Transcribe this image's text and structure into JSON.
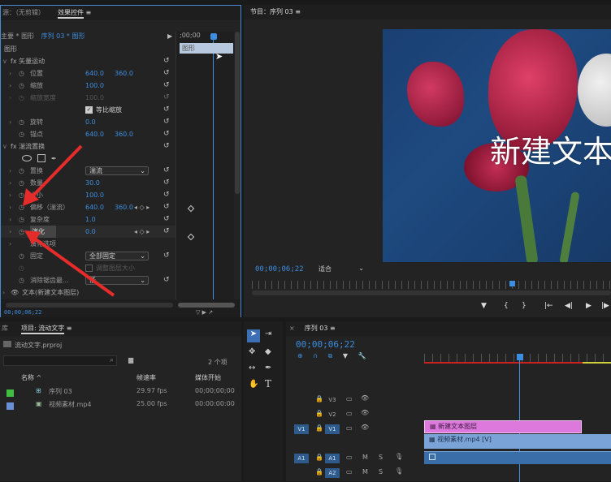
{
  "colors": {
    "accent": "#3d8ee0",
    "clip_pink": "#dd78dd",
    "clip_blue": "#7aa4d8",
    "arrow_red": "#e62b2b"
  },
  "effect_controls": {
    "tab_source": "源：（无剪辑）",
    "tab_effects": "效果控件",
    "tab_menu": "≡",
    "master": "主要 * 图形",
    "sequence": "序列 03 * 图形",
    "ruler_time": ";00;00",
    "graphic_clip": "图形",
    "section_graphic": "图形",
    "rows": [
      {
        "label": "fx  矢量运动"
      },
      {
        "label": "位置",
        "v1": "640.0",
        "v2": "360.0"
      },
      {
        "label": "缩放",
        "v1": "100.0"
      },
      {
        "label": "缩放宽度",
        "v1": "100.0"
      },
      {
        "label": "等比缩放"
      },
      {
        "label": "旋转",
        "v1": "0.0"
      },
      {
        "label": "锚点",
        "v1": "640.0",
        "v2": "360.0"
      },
      {
        "label": "fx  湍流置换"
      },
      {
        "label": "置换",
        "dropdown": "湍流"
      },
      {
        "label": "数量",
        "v1": "30.0"
      },
      {
        "label": "大小",
        "v1": "100.0"
      },
      {
        "label": "偏移（湍流）",
        "v1": "640.0",
        "v2": "360.0"
      },
      {
        "label": "复杂度",
        "v1": "1.0"
      },
      {
        "label": "演化",
        "v1": "0.0"
      },
      {
        "label": "演化选项"
      },
      {
        "label": "固定",
        "dropdown": "全部固定"
      },
      {
        "label": "调整图层大小"
      },
      {
        "label": "消除锯齿最...",
        "dropdown": "低"
      },
      {
        "label": "文本(新建文本图层)"
      },
      {
        "label": "视频"
      }
    ],
    "timecode": "00;00;06;22"
  },
  "program": {
    "title": "节目：序列 03",
    "tab_menu": "≡",
    "overlay_text": "新建文本",
    "timecode": "00;00;06;22",
    "fit": "适合",
    "controls": [
      "▼",
      "{",
      "}",
      "|←",
      "◀|",
      "▶",
      "|▶"
    ]
  },
  "project": {
    "tab_lib": "库",
    "tab_project": "项目: 流动文字",
    "tab_menu": "≡",
    "file": "流动文字.prproj",
    "count": "2 个项",
    "columns": [
      "名称 ^",
      "帧速率",
      "媒体开始"
    ],
    "items": [
      {
        "name": "序列 03",
        "fps": "29.97 fps",
        "start": "00;00;00;00",
        "color": "#3fbf3f"
      },
      {
        "name": "视频素材.mp4",
        "fps": "25.00 fps",
        "start": "00:00:00:00",
        "color": "#6a8fd8"
      }
    ]
  },
  "timeline": {
    "tab_close": "×",
    "title": "序列 03",
    "tab_menu": "≡",
    "timecode": "00;00;06;22",
    "tracks": [
      {
        "name": "V3",
        "src": ""
      },
      {
        "name": "V2",
        "src": ""
      },
      {
        "name": "V1",
        "src": "V1"
      },
      {
        "name": "A1",
        "src": "A1"
      },
      {
        "name": "A2",
        "src": ""
      }
    ],
    "clip_text": "新建文本图层",
    "clip_video": "视频素材.mp4 [V]"
  }
}
